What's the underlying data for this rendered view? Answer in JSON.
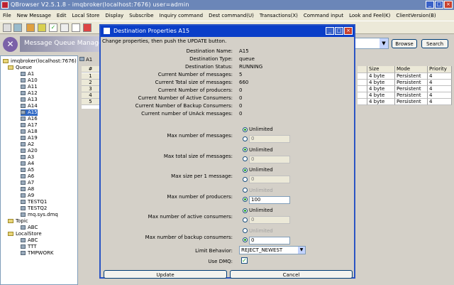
{
  "window": {
    "title": "QBrowser V2.5.1.8 - imqbroker(localhost:7676) user=admin"
  },
  "menu": [
    "File",
    "New Message",
    "Edit",
    "Local Store",
    "Display",
    "Subscribe",
    "Inquiry command",
    "Dest command(U)",
    "Transactions(X)",
    "Command input",
    "Look and Feel(K)",
    "ClientVersion(B)"
  ],
  "banner": {
    "title": "Message Queue Manageme"
  },
  "buttons": {
    "browse": "Browse",
    "search": "Search"
  },
  "tree": {
    "root": "imqbroker(localhost:7676)",
    "queue_label": "Queue",
    "queues": [
      "A1",
      "A10",
      "A11",
      "A12",
      "A13",
      "A14",
      "A15",
      "A16",
      "A17",
      "A18",
      "A19",
      "A2",
      "A20",
      "A3",
      "A4",
      "A5",
      "A6",
      "A7",
      "A8",
      "A9",
      "TESTQ1",
      "TESTQ2",
      "mq.sys.dmq"
    ],
    "topic_label": "Topic",
    "topics": [
      "ABC"
    ],
    "localstore_label": "LocalStore",
    "localstores": [
      "ABC",
      "TTT",
      "TMPWORK"
    ]
  },
  "tab": {
    "label": "A1"
  },
  "grid": {
    "header": "#",
    "rows": [
      "1",
      "2",
      "3",
      "4",
      "5"
    ]
  },
  "table": {
    "columns": [
      "",
      "Size",
      "Mode",
      "Priority"
    ],
    "rows": [
      [
        "",
        "4 byte",
        "Persistent",
        "4"
      ],
      [
        "",
        "4 byte",
        "Persistent",
        "4"
      ],
      [
        "",
        "4 byte",
        "Persistent",
        "4"
      ],
      [
        "",
        "4 byte",
        "Persistent",
        "4"
      ],
      [
        "",
        "4 byte",
        "Persistent",
        "4"
      ]
    ]
  },
  "dialog": {
    "title": "Destination Properties A15",
    "message": "Change properties, then push the UPDATE button.",
    "props": [
      {
        "label": "Destination Name:",
        "value": "A15"
      },
      {
        "label": "Destination Type:",
        "value": "queue"
      },
      {
        "label": "Destination Status:",
        "value": "RUNNING"
      },
      {
        "label": "Current Number of messages:",
        "value": "5"
      },
      {
        "label": "Current Total size of messages:",
        "value": "660"
      },
      {
        "label": "Current Number of producers:",
        "value": "0"
      },
      {
        "label": "Current Number of Active Consumers:",
        "value": "0"
      },
      {
        "label": "Current Number of Backup Consumers:",
        "value": "0"
      },
      {
        "label": "Current number of UnAck messages:",
        "value": "0"
      }
    ],
    "limits": [
      {
        "label": "Max number of messages:",
        "unlimited": "Unlimited",
        "value": "0",
        "selected": "unlimited"
      },
      {
        "label": "Max total size of messages:",
        "unlimited": "Unlimited",
        "value": "0",
        "selected": "unlimited"
      },
      {
        "label": "Max size per 1 message:",
        "unlimited": "Unlimited",
        "value": "0",
        "selected": "unlimited"
      },
      {
        "label": "Max number of producers:",
        "unlimited": "Unlimited",
        "value": "100",
        "selected": "value"
      },
      {
        "label": "Max number of active consumers:",
        "unlimited": "Unlimited",
        "value": "0",
        "selected": "unlimited"
      },
      {
        "label": "Max number of backup consumers:",
        "unlimited": "Unlimited",
        "value": "0",
        "selected": "value"
      }
    ],
    "limit_behavior_label": "Limit Behavior:",
    "limit_behavior_value": "REJECT_NEWEST",
    "use_dmq_label": "Use DMQ:",
    "use_dmq_checked": true,
    "update_label": "Update",
    "cancel_label": "Cancel"
  }
}
